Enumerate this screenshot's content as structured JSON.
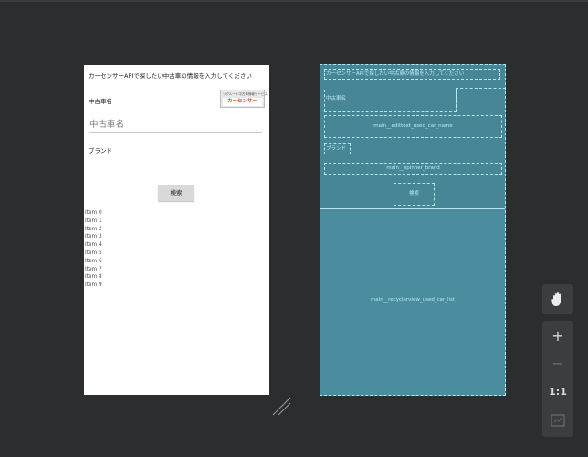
{
  "design": {
    "header_text": "カーセンサーAPIで探したい中古車の情報を入力してください",
    "used_car_name_label": "中古車名",
    "logo_small": "リクルート中古車情報サービス",
    "logo_main": "カーセンサー",
    "name_edittext_hint": "中古車名",
    "brand_label": "ブランド",
    "search_button": "検索",
    "list_items": [
      "Item 0",
      "Item 1",
      "Item 2",
      "Item 3",
      "Item 4",
      "Item 5",
      "Item 6",
      "Item 7",
      "Item 8",
      "Item 9"
    ]
  },
  "blueprint": {
    "header_text": "カーセンサーAPIで探したい中古車の情報を入力してください",
    "name_label": "中古車名",
    "edittext_id": "main__edittext_used_car_name",
    "brand_label": "ブランド",
    "spinner_id": "main__spinner_brand",
    "search_button": "検索",
    "recyclerview_id": "main__recyclerview_used_car_list"
  },
  "toolbar": {
    "pan_icon": "hand-icon",
    "zoom_in": "+",
    "zoom_out": "−",
    "actual_size": "1:1",
    "fit_icon": "fit-screen-icon"
  },
  "colors": {
    "canvas": "#2b2d2e",
    "blueprint_fill": "#4a8d9e",
    "blueprint_line": "#b8e7f1",
    "toolbar": "#3b3e40"
  }
}
